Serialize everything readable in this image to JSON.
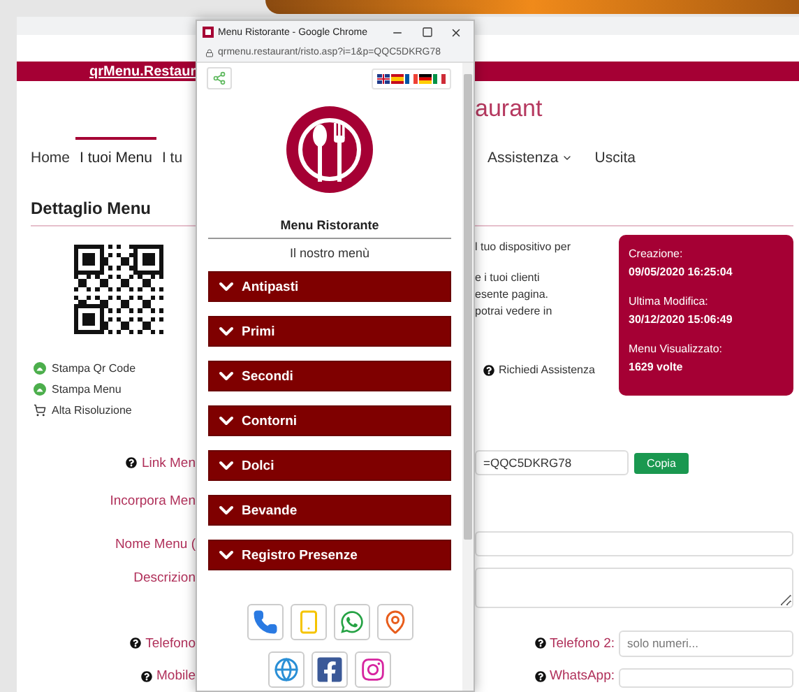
{
  "top_bar": {
    "link": "qrMenu.Restaur"
  },
  "logo_text": "aurant",
  "nav": {
    "left": [
      {
        "label": "Home",
        "selected": false
      },
      {
        "label": "I tuoi Menu",
        "selected": true
      },
      {
        "label": "I tu",
        "selected": false
      }
    ],
    "right": [
      {
        "label": "Assistenza",
        "dropdown": true,
        "selected": false
      },
      {
        "label": "Uscita",
        "dropdown": false,
        "selected": false
      }
    ]
  },
  "section_title": "Dettaglio Menu",
  "actions": [
    {
      "kind": "print",
      "label": "Stampa Qr Code"
    },
    {
      "kind": "print",
      "label": "Stampa Menu"
    },
    {
      "kind": "cart",
      "label": "Alta Risoluzione"
    }
  ],
  "info_paragraphs": [
    {
      "lines": [
        "l tuo dispositivo per"
      ]
    },
    {
      "lines": [
        "e i tuoi clienti",
        "esente pagina.",
        "potrai vedere in"
      ]
    }
  ],
  "help_link": "Richiedi Assistenza",
  "stats": [
    {
      "label": "Creazione:",
      "value": "09/05/2020 16:25:04"
    },
    {
      "label": "Ultima Modifica:",
      "value": "30/12/2020 15:06:49"
    },
    {
      "label": "Menu Visualizzato:",
      "value": "1629 volte"
    }
  ],
  "form": [
    {
      "kind": "link",
      "label": "Link Men",
      "help": true,
      "value": "=QQC5DKRG78",
      "button": "Copia"
    },
    {
      "kind": "plain",
      "label": "Incorpora Men",
      "help": false
    },
    {
      "kind": "text",
      "label": "Nome Menu (",
      "help": false
    },
    {
      "kind": "textarea",
      "label": "Descrizion",
      "help": false
    },
    {
      "kind": "pair",
      "label": "Telefono",
      "help": true,
      "label_2": "Telefono 2:",
      "placeholder_2": "solo numeri..."
    },
    {
      "kind": "pair",
      "label": "Mobile",
      "help": true,
      "label_2": "WhatsApp:"
    }
  ],
  "popup": {
    "title": "Menu Ristorante - Google Chrome",
    "url": "qrmenu.restaurant/risto.asp?i=1&p=QQC5DKRG78",
    "languages": [
      {
        "kind": "en"
      },
      {
        "kind": "es"
      },
      {
        "kind": "fr"
      },
      {
        "kind": "de"
      },
      {
        "kind": "it"
      }
    ],
    "name": "Menu Ristorante",
    "subtitle": "Il nostro menù",
    "categories": [
      {
        "label": "Antipasti"
      },
      {
        "label": "Primi"
      },
      {
        "label": "Secondi"
      },
      {
        "label": "Contorni"
      },
      {
        "label": "Dolci"
      },
      {
        "label": "Bevande"
      },
      {
        "label": "Registro Presenze"
      }
    ],
    "contacts": [
      {
        "kind": "phone"
      },
      {
        "kind": "mobile"
      },
      {
        "kind": "whatsapp"
      },
      {
        "kind": "map"
      },
      {
        "kind": "web"
      },
      {
        "kind": "facebook"
      },
      {
        "kind": "instagram"
      }
    ]
  }
}
